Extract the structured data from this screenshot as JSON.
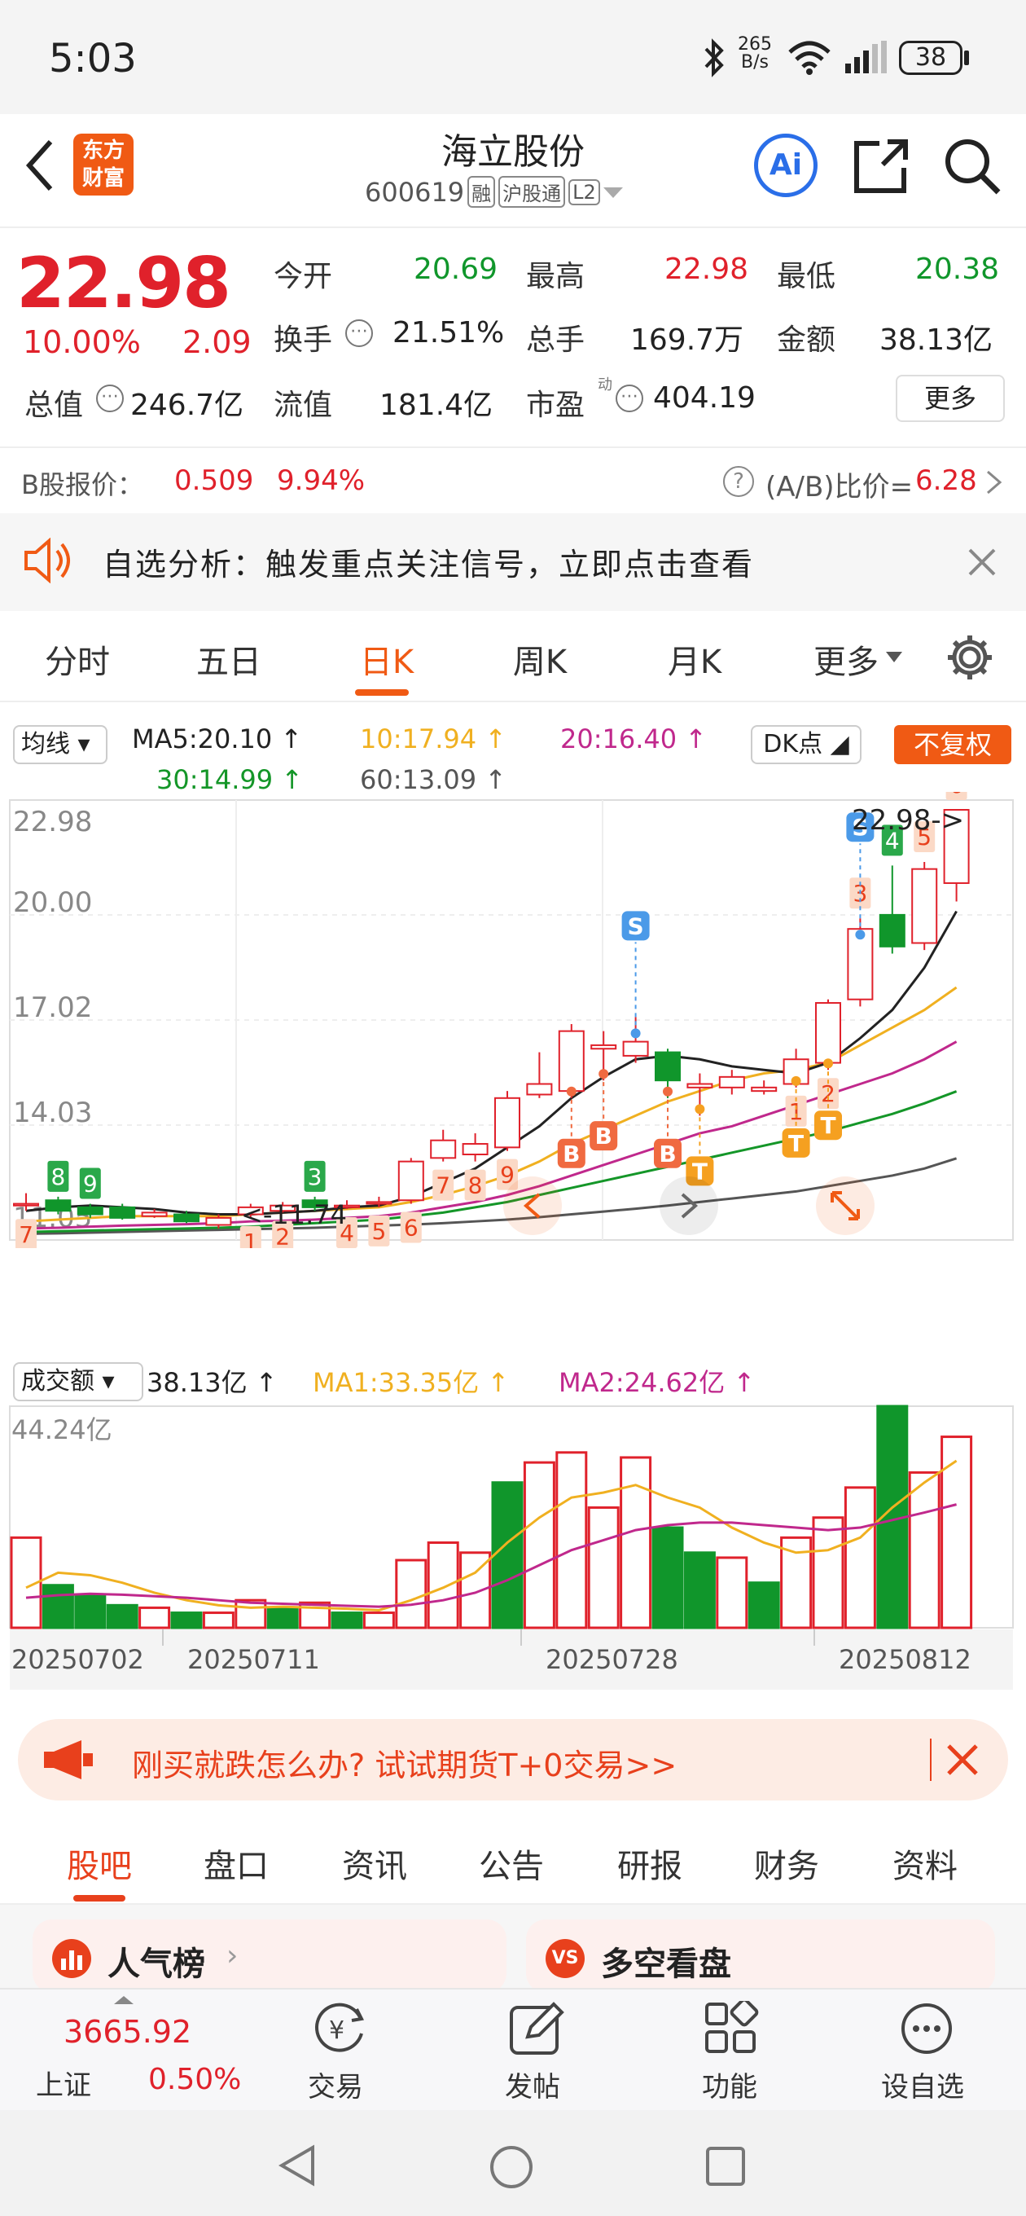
{
  "status": {
    "time": "5:03",
    "net_speed_top": "265",
    "net_speed_unit": "B/s",
    "battery": "38"
  },
  "header": {
    "title": "海立股份",
    "code": "600619",
    "badge_rong": "融",
    "badge_hgt": "沪股通",
    "badge_l2": "L2",
    "logo_line1": "东方",
    "logo_line2": "财富",
    "ai_label": "Ai"
  },
  "quote": {
    "price": "22.98",
    "pct": "10.00%",
    "chg": "2.09",
    "open_label": "今开",
    "open": "20.69",
    "high_label": "最高",
    "high": "22.98",
    "low_label": "最低",
    "low": "20.38",
    "turnover_label": "换手",
    "turnover": "21.51%",
    "volume_label": "总手",
    "volume": "169.7万",
    "amount_label": "金额",
    "amount": "38.13亿",
    "mktcap_label": "总值",
    "mktcap": "246.7亿",
    "float_label": "流值",
    "float": "181.4亿",
    "pe_label": "市盈",
    "pe_sup": "动",
    "pe": "404.19",
    "more": "更多",
    "b_label": "B股报价：",
    "b_price": "0.509",
    "b_pct": "9.94%",
    "ab_label": "(A/B)比价=",
    "ab_value": "6.28"
  },
  "notice": {
    "text": "自选分析：触发重点关注信号，立即点击查看"
  },
  "period_tabs": [
    "分时",
    "五日",
    "日K",
    "周K",
    "月K",
    "更多"
  ],
  "period_active": 2,
  "ma": {
    "selector": "均线",
    "ma5": "MA5:20.10",
    "ma10": "10:17.94",
    "ma20": "20:16.40",
    "ma30": "30:14.99",
    "ma60": "60:13.09",
    "dk": "DK点",
    "fq": "不复权",
    "c5": "#222222",
    "c10": "#f0b020",
    "c20": "#c0288c",
    "c30": "#149628",
    "c60": "#555555"
  },
  "chart_data": [
    {
      "type": "candlestick",
      "y_ticks": [
        "22.98",
        "20.00",
        "17.02",
        "14.03",
        "11.05"
      ],
      "ylim": [
        11.05,
        22.98
      ],
      "last_price_label": "22.98",
      "min_label": "11.74",
      "candles": [
        {
          "o": 11.75,
          "c": 11.8,
          "h": 12.1,
          "l": 11.6
        },
        {
          "o": 11.9,
          "c": 11.6,
          "h": 12.0,
          "l": 11.5
        },
        {
          "o": 11.7,
          "c": 11.5,
          "h": 11.8,
          "l": 11.4
        },
        {
          "o": 11.7,
          "c": 11.4,
          "h": 11.8,
          "l": 11.35
        },
        {
          "o": 11.45,
          "c": 11.55,
          "h": 11.65,
          "l": 11.4
        },
        {
          "o": 11.5,
          "c": 11.3,
          "h": 11.6,
          "l": 11.25
        },
        {
          "o": 11.2,
          "c": 11.4,
          "h": 11.5,
          "l": 11.1
        },
        {
          "o": 11.5,
          "c": 11.7,
          "h": 11.8,
          "l": 11.4
        },
        {
          "o": 11.6,
          "c": 11.75,
          "h": 11.85,
          "l": 11.55
        },
        {
          "o": 11.9,
          "c": 11.7,
          "h": 12.0,
          "l": 11.6
        },
        {
          "o": 11.7,
          "c": 11.75,
          "h": 11.9,
          "l": 11.65
        },
        {
          "o": 11.8,
          "c": 11.85,
          "h": 12.0,
          "l": 11.7
        },
        {
          "o": 11.9,
          "c": 13.0,
          "h": 13.1,
          "l": 11.8
        },
        {
          "o": 13.1,
          "c": 13.6,
          "h": 13.9,
          "l": 13.0
        },
        {
          "o": 13.2,
          "c": 13.5,
          "h": 13.8,
          "l": 13.0
        },
        {
          "o": 13.4,
          "c": 14.8,
          "h": 15.0,
          "l": 13.3
        },
        {
          "o": 14.9,
          "c": 15.2,
          "h": 16.1,
          "l": 14.8
        },
        {
          "o": 15.0,
          "c": 16.7,
          "h": 16.9,
          "l": 14.8
        },
        {
          "o": 16.2,
          "c": 16.3,
          "h": 16.7,
          "l": 15.3
        },
        {
          "o": 16.0,
          "c": 16.4,
          "h": 17.1,
          "l": 15.8
        },
        {
          "o": 16.1,
          "c": 15.3,
          "h": 16.2,
          "l": 14.8
        },
        {
          "o": 15.1,
          "c": 15.2,
          "h": 15.5,
          "l": 14.3
        },
        {
          "o": 15.1,
          "c": 15.4,
          "h": 15.6,
          "l": 14.9
        },
        {
          "o": 15.0,
          "c": 15.1,
          "h": 15.3,
          "l": 14.9
        },
        {
          "o": 15.2,
          "c": 15.9,
          "h": 16.2,
          "l": 15.1
        },
        {
          "o": 15.8,
          "c": 17.5,
          "h": 17.6,
          "l": 15.6
        },
        {
          "o": 17.6,
          "c": 19.6,
          "h": 19.9,
          "l": 17.4
        },
        {
          "o": 20.0,
          "c": 19.1,
          "h": 21.4,
          "l": 18.9
        },
        {
          "o": 19.2,
          "c": 21.3,
          "h": 21.5,
          "l": 19.0
        },
        {
          "o": 20.9,
          "c": 22.98,
          "h": 22.98,
          "l": 20.38
        }
      ],
      "ma5": [
        11.6,
        11.7,
        11.75,
        11.7,
        11.65,
        11.55,
        11.5,
        11.5,
        11.55,
        11.6,
        11.7,
        11.75,
        12.0,
        12.4,
        12.8,
        13.4,
        14.0,
        14.8,
        15.4,
        15.9,
        16.0,
        15.9,
        15.7,
        15.6,
        15.5,
        15.8,
        16.5,
        17.3,
        18.5,
        20.1
      ],
      "ma10": [
        11.3,
        11.35,
        11.4,
        11.45,
        11.45,
        11.45,
        11.45,
        11.5,
        11.55,
        11.6,
        11.65,
        11.7,
        11.85,
        12.05,
        12.3,
        12.6,
        13.0,
        13.5,
        13.9,
        14.3,
        14.7,
        15.0,
        15.3,
        15.5,
        15.6,
        15.8,
        16.3,
        16.8,
        17.3,
        17.94
      ],
      "ma20": [
        11.1,
        11.12,
        11.15,
        11.18,
        11.2,
        11.22,
        11.25,
        11.3,
        11.32,
        11.35,
        11.4,
        11.45,
        11.55,
        11.7,
        11.85,
        12.05,
        12.3,
        12.6,
        12.9,
        13.2,
        13.5,
        13.8,
        14.0,
        14.3,
        14.6,
        14.9,
        15.2,
        15.5,
        15.9,
        16.4
      ],
      "ma30": [
        11.0,
        11.02,
        11.04,
        11.06,
        11.08,
        11.1,
        11.12,
        11.15,
        11.2,
        11.25,
        11.3,
        11.35,
        11.45,
        11.55,
        11.7,
        11.85,
        12.05,
        12.25,
        12.45,
        12.65,
        12.85,
        13.05,
        13.25,
        13.45,
        13.65,
        13.85,
        14.1,
        14.35,
        14.65,
        14.99
      ],
      "ma60": [
        10.95,
        10.96,
        10.98,
        11.0,
        11.02,
        11.04,
        11.06,
        11.08,
        11.1,
        11.12,
        11.15,
        11.18,
        11.21,
        11.25,
        11.3,
        11.35,
        11.42,
        11.5,
        11.58,
        11.66,
        11.75,
        11.85,
        11.95,
        12.05,
        12.15,
        12.3,
        12.45,
        12.6,
        12.8,
        13.09
      ],
      "count_labels": [
        {
          "i": 0,
          "t": "7"
        },
        {
          "i": 1,
          "t": "8"
        },
        {
          "i": 2,
          "t": "9"
        },
        {
          "i": 7,
          "t": "1"
        },
        {
          "i": 8,
          "t": "2"
        },
        {
          "i": 9,
          "t": "3"
        },
        {
          "i": 10,
          "t": "4"
        },
        {
          "i": 11,
          "t": "5"
        },
        {
          "i": 12,
          "t": "6"
        },
        {
          "i": 13,
          "t": "7"
        },
        {
          "i": 14,
          "t": "8"
        },
        {
          "i": 15,
          "t": "9"
        },
        {
          "i": 24,
          "t": "1"
        },
        {
          "i": 25,
          "t": "2"
        },
        {
          "i": 26,
          "t": "3"
        },
        {
          "i": 27,
          "t": "4"
        },
        {
          "i": 28,
          "t": "5"
        },
        {
          "i": 29,
          "t": "6"
        }
      ],
      "signals": [
        {
          "i": 17,
          "t": "B"
        },
        {
          "i": 18,
          "t": "B"
        },
        {
          "i": 20,
          "t": "B"
        },
        {
          "i": 21,
          "t": "T"
        },
        {
          "i": 24,
          "t": "T"
        },
        {
          "i": 25,
          "t": "T"
        },
        {
          "i": 19,
          "t": "S"
        },
        {
          "i": 26,
          "t": "S"
        }
      ]
    },
    {
      "type": "bar",
      "label": "成交额",
      "current": "38.13亿",
      "ma1": "MA1:33.35亿",
      "ma2": "MA2:24.62亿",
      "max_label": "44.24亿",
      "ylim": [
        0,
        44.24
      ],
      "x_ticks": [
        "20250702",
        "20250711",
        "20250728",
        "20250812"
      ],
      "values": [
        18,
        8.5,
        6.5,
        4.5,
        4,
        3,
        3,
        5.5,
        4,
        5,
        3,
        3,
        13.5,
        17,
        15,
        29,
        33,
        35,
        24,
        34,
        20,
        15,
        14,
        9,
        18,
        22,
        28,
        44.24,
        31,
        38.13
      ],
      "up": [
        true,
        false,
        false,
        false,
        true,
        false,
        true,
        true,
        false,
        true,
        false,
        true,
        true,
        true,
        true,
        false,
        true,
        true,
        true,
        true,
        false,
        false,
        true,
        false,
        true,
        true,
        true,
        false,
        true,
        true
      ],
      "ma1_values": [
        8,
        11,
        10.5,
        9,
        7,
        5.5,
        4.5,
        4,
        4.2,
        4,
        3.8,
        3.5,
        5.5,
        8,
        11,
        17,
        22,
        26,
        27,
        28.5,
        26,
        24,
        20,
        17,
        15,
        15.5,
        18,
        24,
        29,
        33.35
      ],
      "ma2_values": [
        6,
        6.5,
        6.8,
        6.6,
        6.3,
        6,
        5.5,
        5,
        4.8,
        4.6,
        4.4,
        4.2,
        4.6,
        5.5,
        7,
        9.5,
        12.5,
        15.5,
        17.5,
        19.5,
        20.5,
        21,
        21,
        20.5,
        20,
        19.5,
        20,
        21.5,
        23,
        24.62
      ]
    }
  ],
  "promo": {
    "text": "刚买就跌怎么办? 试试期货T+0交易>>"
  },
  "section_tabs": [
    "股吧",
    "盘口",
    "资讯",
    "公告",
    "研报",
    "财务",
    "资料"
  ],
  "section_active": 0,
  "cards": [
    {
      "label": "人气榜"
    },
    {
      "label": "多空看盘",
      "badge": "VS"
    }
  ],
  "bottom_nav": {
    "index_value": "3665.92",
    "index_name": "上证",
    "index_pct": "0.50%",
    "trade": "交易",
    "post": "发帖",
    "func": "功能",
    "watch": "设自选"
  },
  "colors": {
    "up": "#e0212b",
    "down": "#10962b",
    "accent": "#f05a14"
  }
}
